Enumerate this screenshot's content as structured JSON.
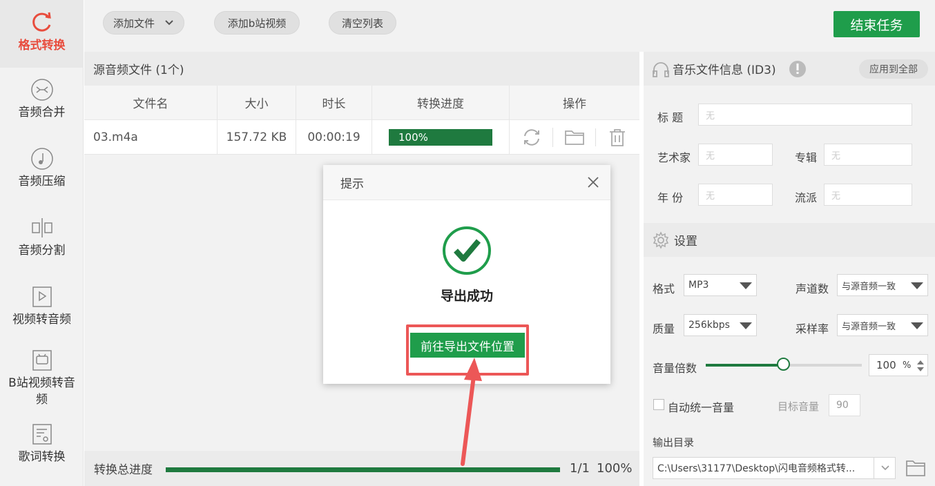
{
  "sidebar": {
    "items": [
      {
        "label": "格式转换",
        "icon": "refresh-icon",
        "active": true
      },
      {
        "label": "音频合并",
        "icon": "merge-icon"
      },
      {
        "label": "音频压缩",
        "icon": "compress-icon"
      },
      {
        "label": "音频分割",
        "icon": "split-icon"
      },
      {
        "label": "视频转音频",
        "icon": "video-icon"
      },
      {
        "label_line1": "B站视频转音",
        "label_line2": "频",
        "icon": "bilibili-icon"
      },
      {
        "label": "歌词转换",
        "icon": "lyrics-icon"
      }
    ]
  },
  "toolbar": {
    "add_file": "添加文件",
    "add_bilibili": "添加b站视频",
    "clear_list": "清空列表",
    "end_task": "结束任务"
  },
  "file_panel": {
    "title": "源音频文件 (1个)",
    "columns": [
      "文件名",
      "大小",
      "时长",
      "转换进度",
      "操作"
    ],
    "rows": [
      {
        "name": "03.m4a",
        "size": "157.72 KB",
        "duration": "00:00:19",
        "progress_text": "100%",
        "progress": 1.0
      }
    ],
    "total_label": "转换总进度",
    "total_count": "1/1",
    "total_pct": "100%",
    "total_progress": 1.0
  },
  "id3": {
    "title": "音乐文件信息 (ID3)",
    "apply_all": "应用到全部",
    "title_label": "标 题",
    "artist_label": "艺术家",
    "album_label": "专辑",
    "year_label": "年 份",
    "genre_label": "流派",
    "empty_placeholder": "无"
  },
  "settings": {
    "title": "设置",
    "format_label": "格式",
    "format_value": "MP3",
    "channels_label": "声道数",
    "channels_value": "与源音频一致",
    "quality_label": "质量",
    "quality_value": "256kbps",
    "samplerate_label": "采样率",
    "samplerate_value": "与源音频一致",
    "volume_label": "音量倍数",
    "volume_value": "100",
    "volume_unit": "%",
    "volume_level": 0.5,
    "auto_volume_label": "自动统一音量",
    "target_volume_label": "目标音量",
    "target_volume_value": "90",
    "output_label": "输出目录",
    "output_path": "C:\\Users\\31177\\Desktop\\闪电音频格式转..."
  },
  "modal": {
    "title": "提示",
    "message": "导出成功",
    "button": "前往导出文件位置"
  },
  "colors": {
    "accent_green": "#1f9d4b",
    "progress_green": "#1f7a3f",
    "active_red": "#e84c3d",
    "highlight_red": "#ec5757"
  }
}
